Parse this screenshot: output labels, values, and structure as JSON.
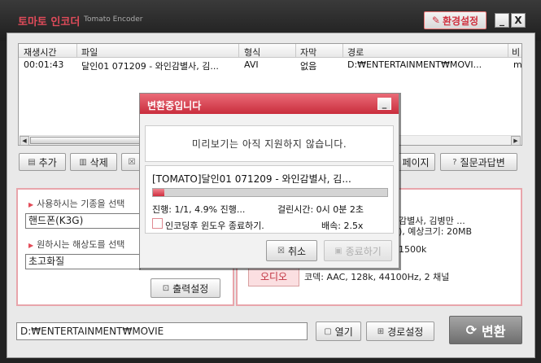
{
  "app": {
    "title": "토마토 인코더",
    "subtitle": "Tomato Encoder",
    "settings_label": "환경설정",
    "minimize_label": "_",
    "close_label": "X"
  },
  "table": {
    "columns": [
      "재생시간",
      "파일",
      "형식",
      "자막",
      "경로",
      "비"
    ],
    "rows": [
      {
        "duration": "00:01:43",
        "file": "달인01 071209 - 와인감별사, 김...",
        "format": "AVI",
        "subtitle": "없음",
        "path": "D:₩ENTERTAINMENT₩MOVI...",
        "extra": "m"
      }
    ]
  },
  "toolbar": {
    "add_label": "추가",
    "delete_label": "삭제",
    "page_label": "페이지",
    "qa_label": "질문과답변"
  },
  "left_panel": {
    "device_label": "사용하시는 기종을 선택",
    "device_value": "핸드폰(K3G)",
    "resolution_label": "원하시는 해상도를 선택",
    "resolution_value": "초고화질",
    "output_settings_label": "출력설정"
  },
  "right_panel": {
    "file_info_1": "감별사, 김병만 ...",
    "file_info_2": "), 예상크기: 20MB",
    "video_info": "1500k",
    "audio_key": "오디오",
    "audio_info": "코덱: AAC, 128k, 44100Hz, 2 채널"
  },
  "bottom": {
    "path": "D:₩ENTERTAINMENT₩MOVIE",
    "open_label": "열기",
    "path_settings_label": "경로설정",
    "convert_label": "변환"
  },
  "modal": {
    "title": "변환중입니다",
    "preview_message": "미리보기는 아직 지원하지 않습니다.",
    "file_name": "[TOMATO]달인01 071209 - 와인감별사, 김...",
    "progress_fraction": 0.049,
    "progress_text": "진행: 1/1, 4.9% 진행...",
    "elapsed_text": "걸린시간: 0시 0분 2초",
    "close_after_label": "인코딩후 윈도우 종료하기.",
    "speed_text": "배속: 2.5x",
    "cancel_label": "취소",
    "quit_label": "종료하기"
  }
}
